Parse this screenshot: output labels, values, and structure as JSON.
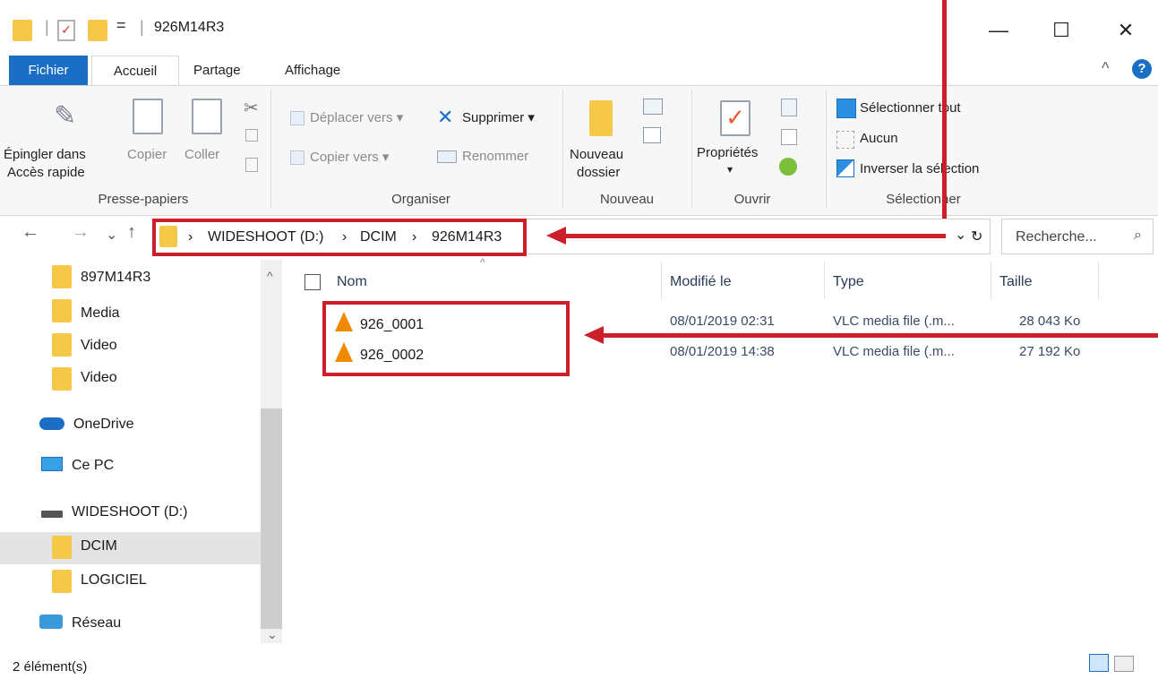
{
  "window": {
    "title": "926M14R3",
    "separator": "|",
    "minimize_glyph": "—",
    "maximize_glyph": "☐",
    "close_glyph": "✕",
    "qa_dropdown_glyph": "="
  },
  "ribbon": {
    "tabs": [
      "Fichier",
      "Accueil",
      "Partage",
      "Affichage"
    ],
    "collapse_glyph": "^",
    "help_glyph": "?",
    "groups": {
      "presse_papiers": {
        "label": "Presse-papiers",
        "pin_line1": "Épingler dans",
        "pin_line2": "Accès rapide",
        "copy": "Copier",
        "paste": "Coller"
      },
      "organiser": {
        "label": "Organiser",
        "move": "Déplacer vers ▾",
        "copy_to": "Copier vers ▾",
        "delete": "Supprimer ▾",
        "rename": "Renommer"
      },
      "nouveau": {
        "label": "Nouveau",
        "new_folder_line1": "Nouveau",
        "new_folder_line2": "dossier"
      },
      "ouvrir": {
        "label": "Ouvrir",
        "properties": "Propriétés",
        "properties_arrow": "▾"
      },
      "selectionner": {
        "label": "Sélectionner",
        "select_all": "Sélectionner tout",
        "none": "Aucun",
        "invert": "Inverser la sélection"
      }
    }
  },
  "address": {
    "back": "←",
    "forward": "→",
    "recent": "⌄",
    "up": "↑",
    "breadcrumb": [
      "WIDESHOOT (D:)",
      "DCIM",
      "926M14R3"
    ],
    "chevron": "›",
    "dropdown": "⌄",
    "refresh": "↻",
    "search_placeholder": "Recherche...",
    "search_glyph": "⌕"
  },
  "nav_pane": {
    "items": [
      {
        "label": "897M14R3",
        "icon": "folder-icon"
      },
      {
        "label": "Media",
        "icon": "folder-icon"
      },
      {
        "label": "Video",
        "icon": "folder-icon"
      },
      {
        "label": "Video",
        "icon": "folder-icon"
      },
      {
        "label": "OneDrive",
        "icon": "cloud-icon"
      },
      {
        "label": "Ce PC",
        "icon": "computer-icon"
      },
      {
        "label": "WIDESHOOT (D:)",
        "icon": "drive-icon"
      },
      {
        "label": "DCIM",
        "icon": "folder-icon",
        "selected": true
      },
      {
        "label": "LOGICIEL",
        "icon": "folder-icon"
      },
      {
        "label": "Réseau",
        "icon": "network-icon"
      }
    ],
    "scroll_up": "^",
    "scroll_down": "⌄"
  },
  "file_list": {
    "sort_glyph": "^",
    "columns": [
      "Nom",
      "Modifié le",
      "Type",
      "Taille"
    ],
    "rows": [
      {
        "name": "926_0001",
        "modified": "08/01/2019 02:31",
        "type": "VLC media file (.m...",
        "size": "28 043 Ko"
      },
      {
        "name": "926_0002",
        "modified": "08/01/2019 14:38",
        "type": "VLC media file (.m...",
        "size": "27 192 Ko"
      }
    ]
  },
  "status": {
    "count": "2 élément(s)"
  },
  "colors": {
    "accent": "#1a6fc4",
    "annotation": "#cc1f2a",
    "folder": "#f6c84a",
    "vlc": "#f08a00"
  }
}
